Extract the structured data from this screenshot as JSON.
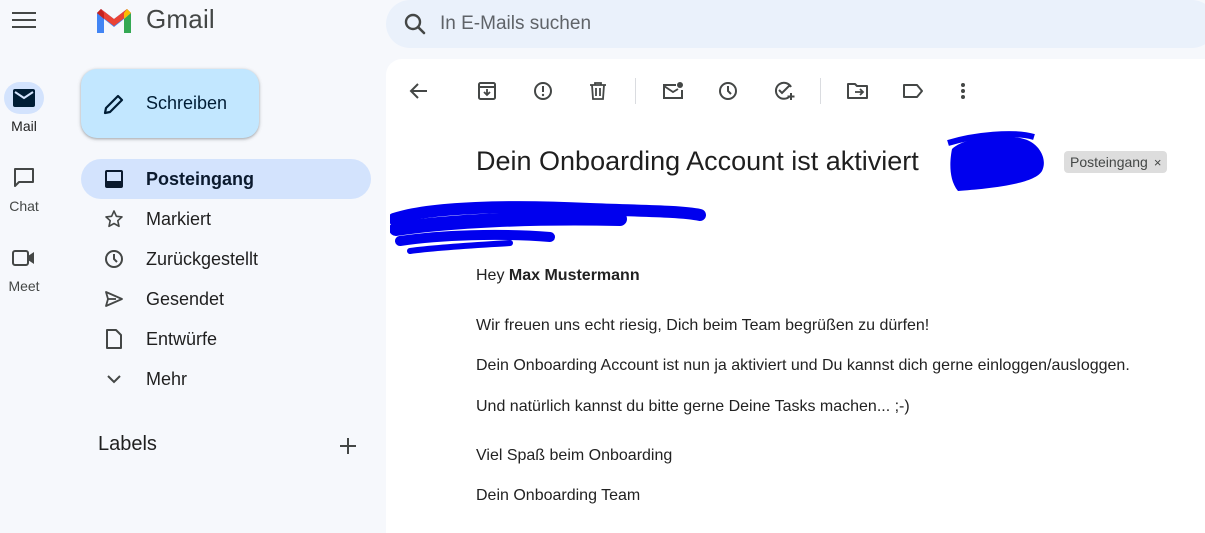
{
  "app": {
    "name": "Gmail"
  },
  "rail": {
    "items": [
      {
        "label": "Mail",
        "icon": "mail-icon",
        "active": true
      },
      {
        "label": "Chat",
        "icon": "chat-icon",
        "active": false
      },
      {
        "label": "Meet",
        "icon": "meet-icon",
        "active": false
      }
    ]
  },
  "search": {
    "placeholder": "In E-Mails suchen"
  },
  "compose": {
    "label": "Schreiben"
  },
  "nav": {
    "items": [
      {
        "label": "Posteingang",
        "icon": "inbox-icon",
        "active": true
      },
      {
        "label": "Markiert",
        "icon": "star-icon"
      },
      {
        "label": "Zurückgestellt",
        "icon": "clock-icon"
      },
      {
        "label": "Gesendet",
        "icon": "send-icon"
      },
      {
        "label": "Entwürfe",
        "icon": "draft-icon"
      },
      {
        "label": "Mehr",
        "icon": "chevron-down-icon"
      }
    ]
  },
  "labels": {
    "heading": "Labels"
  },
  "toolbar": {
    "icons": [
      "back-arrow-icon",
      "archive-icon",
      "report-spam-icon",
      "delete-icon",
      "mark-unread-icon",
      "snooze-icon",
      "add-to-tasks-icon",
      "move-to-icon",
      "label-icon",
      "more-vert-icon"
    ]
  },
  "email": {
    "subject": "Dein Onboarding Account ist aktiviert",
    "label_chip": "Posteingang",
    "chip_close": "×",
    "greeting": "Hey",
    "recipient_name": "Max Mustermann",
    "lines": [
      "Wir freuen uns echt riesig, Dich beim Team begrüßen zu dürfen!",
      "Dein Onboarding Account ist nun ja aktiviert und Du kannst dich gerne einloggen/ausloggen.",
      "Und natürlich kannst du bitte gerne Deine Tasks machen... ;-)",
      "Viel Spaß beim Onboarding",
      "Dein Onboarding Team"
    ]
  },
  "colors": {
    "background": "#f6f8fc",
    "active_nav": "#d3e3fd",
    "compose": "#c2e7ff",
    "search": "#eaf1fb",
    "redaction": "#0000ee",
    "gmail_red": "#ea4335",
    "gmail_blue": "#4285f4",
    "gmail_green": "#34a853",
    "gmail_yellow": "#fbbc04"
  }
}
